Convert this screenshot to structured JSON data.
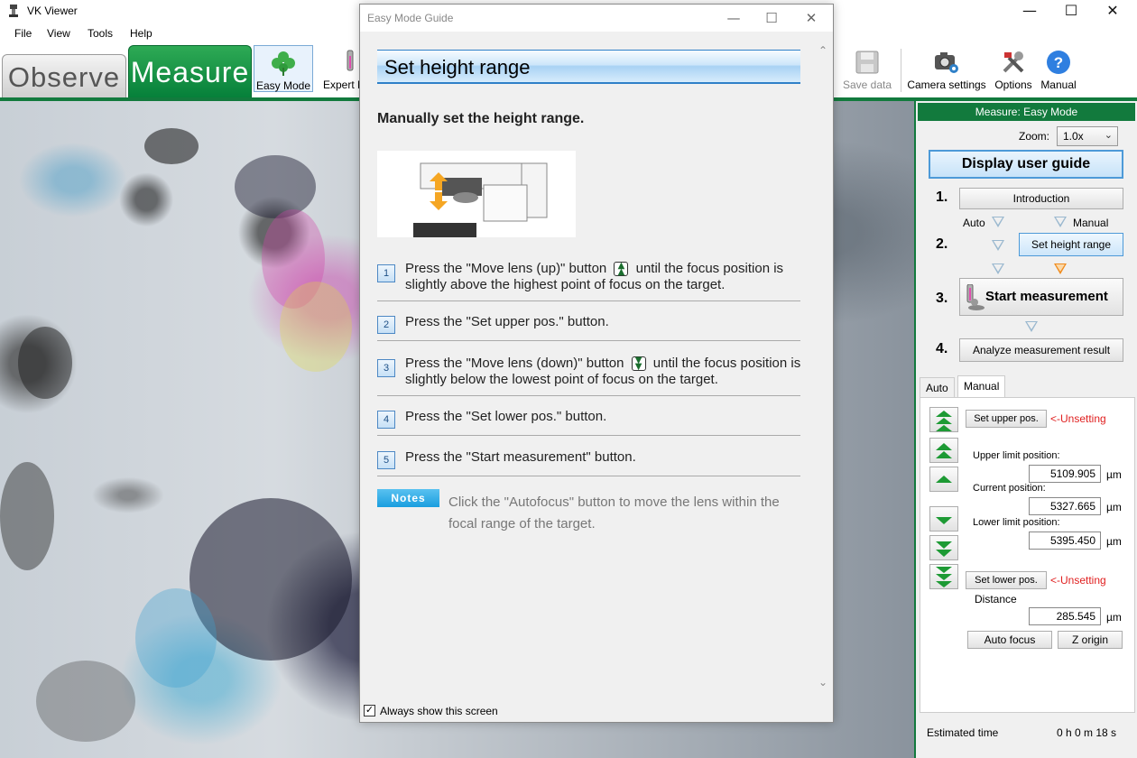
{
  "window": {
    "title": "VK Viewer",
    "minimize_glyph": "—",
    "maximize_glyph": "☐",
    "close_glyph": "✕"
  },
  "menu": [
    "File",
    "View",
    "Tools",
    "Help"
  ],
  "toolbar": {
    "tab_observe": "Observe",
    "tab_measure": "Measure",
    "easy_mode": "Easy Mode",
    "expert_mode": "Expert M",
    "save_data": "Save data",
    "camera_settings": "Camera settings",
    "options": "Options",
    "manual": "Manual"
  },
  "right_panel": {
    "header": "Measure: Easy Mode",
    "zoom_label": "Zoom:",
    "zoom_value": "1.0x",
    "display_guide": "Display user guide",
    "steps": {
      "n1": "1.",
      "n2": "2.",
      "n3": "3.",
      "n4": "4."
    },
    "introduction": "Introduction",
    "auto_label": "Auto",
    "manual_label": "Manual",
    "set_height_range": "Set height range",
    "start_measurement": "Start measurement",
    "analyze": "Analyze measurement result",
    "tabs": {
      "auto": "Auto",
      "manual": "Manual"
    },
    "set_upper": "Set upper pos.",
    "set_lower": "Set lower pos.",
    "unsetting": "<-Unsetting",
    "upper_limit_label": "Upper limit position:",
    "upper_limit_value": "5109.905",
    "current_label": "Current position:",
    "current_value": "5327.665",
    "lower_limit_label": "Lower limit position:",
    "lower_limit_value": "5395.450",
    "distance_label": "Distance",
    "distance_value": "285.545",
    "unit": "µm",
    "auto_focus": "Auto focus",
    "z_origin": "Z origin",
    "estimated_time_label": "Estimated time",
    "estimated_time_value": "0 h 0 m 18 s"
  },
  "dialog": {
    "title": "Easy Mode Guide",
    "heading": "Set height range",
    "subheading": "Manually set the height range.",
    "steps": [
      {
        "num": "1",
        "before": "Press the \"Move lens (up)\" button",
        "after": "until the focus position is slightly above the highest point of focus on the target."
      },
      {
        "num": "2",
        "text": "Press the \"Set upper pos.\" button."
      },
      {
        "num": "3",
        "before": "Press the \"Move lens (down)\" button",
        "after": "until the focus position is slightly below the lowest point of focus on the target."
      },
      {
        "num": "4",
        "text": "Press the \"Set lower pos.\" button."
      },
      {
        "num": "5",
        "text": "Press the \"Start measurement\" button."
      }
    ],
    "notes_label": "Notes",
    "notes_text": "Click the \"Autofocus\" button to move the lens within the focal range of the target.",
    "always_show": "Always show this screen"
  },
  "colors": {
    "brand_green": "#127a3d",
    "accent_blue": "#2f80c8",
    "unset_red": "#e02020",
    "step_orange": "#f08a1c"
  }
}
